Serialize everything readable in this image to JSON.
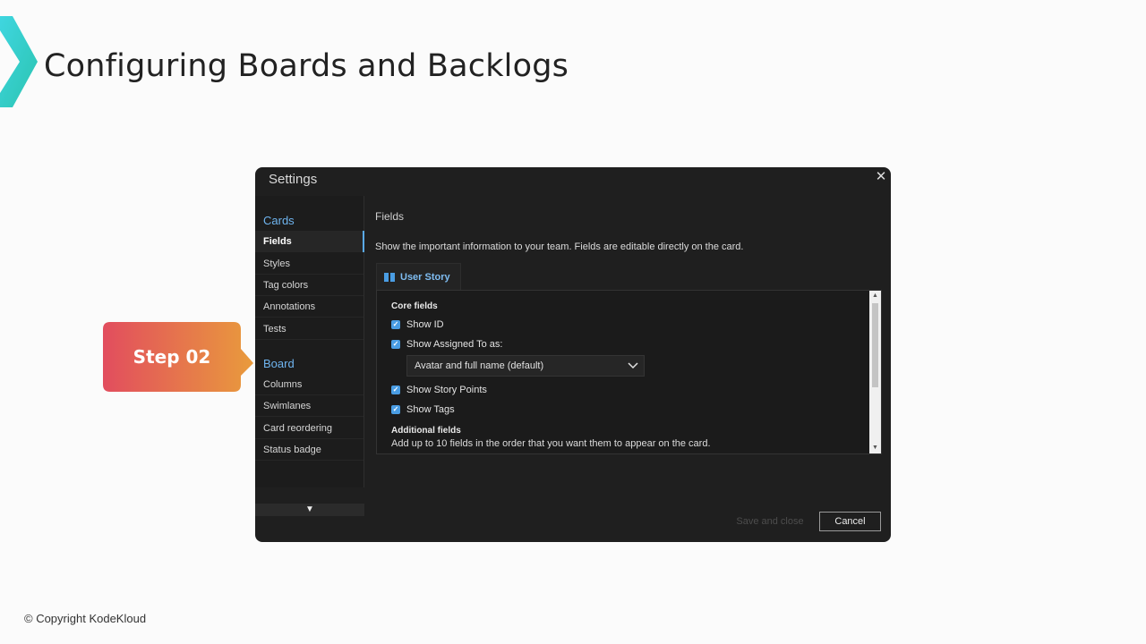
{
  "slide": {
    "title": "Configuring Boards and Backlogs",
    "copyright": "© Copyright KodeKloud",
    "step_label": "Step 02"
  },
  "dialog": {
    "title": "Settings",
    "close_icon": "close-icon",
    "sidebar": {
      "cards_heading": "Cards",
      "cards_items": [
        {
          "label": "Fields",
          "active": true
        },
        {
          "label": "Styles",
          "active": false
        },
        {
          "label": "Tag colors",
          "active": false
        },
        {
          "label": "Annotations",
          "active": false
        },
        {
          "label": "Tests",
          "active": false
        }
      ],
      "board_heading": "Board",
      "board_items": [
        {
          "label": "Columns"
        },
        {
          "label": "Swimlanes"
        },
        {
          "label": "Card reordering"
        },
        {
          "label": "Status badge"
        }
      ],
      "scroll_down_icon": "triangle-down-icon"
    },
    "content": {
      "title": "Fields",
      "description": "Show the important information to your team. Fields are editable directly on the card.",
      "tab_label": "User Story",
      "tab_icon": "book-icon",
      "core_heading": "Core fields",
      "checkboxes": [
        {
          "label": "Show ID",
          "checked": true
        },
        {
          "label": "Show Assigned To as:",
          "checked": true
        },
        {
          "label": "Show Story Points",
          "checked": true
        },
        {
          "label": "Show Tags",
          "checked": true
        }
      ],
      "assigned_dropdown_value": "Avatar and full name (default)",
      "additional_heading": "Additional fields",
      "additional_desc": "Add up to 10 fields in the order that you want them to appear on the card."
    },
    "footer": {
      "save_label": "Save and close",
      "cancel_label": "Cancel"
    }
  },
  "colors": {
    "accent_blue": "#4a9de3",
    "link_blue": "#6fb5f0",
    "dialog_bg": "#1f1f1f",
    "callout_start": "#e24d5e",
    "callout_end": "#e99b3c"
  }
}
